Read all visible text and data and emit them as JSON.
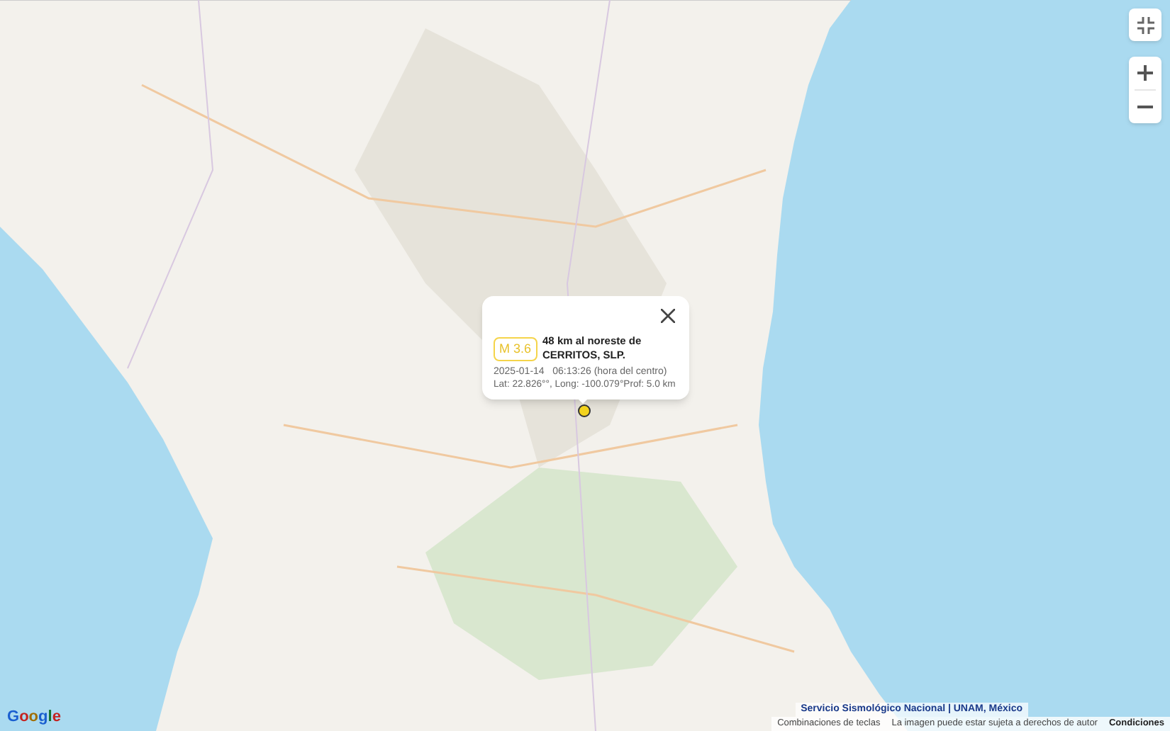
{
  "popup": {
    "magnitude": "M 3.6",
    "place": "48 km al noreste de CERRITOS, SLP.",
    "datetime": "2025-01-14   06:13:26 (hora del centro)",
    "location": "Lat: 22.826°°, Long: -100.079°Prof: 5.0 km"
  },
  "logo": "Google",
  "attribution": {
    "source": "Servicio Sismológico Nacional | UNAM, México",
    "links": [
      "Combinaciones de teclas",
      "La imagen puede estar sujeta a derechos de autor",
      "Condiciones"
    ]
  }
}
